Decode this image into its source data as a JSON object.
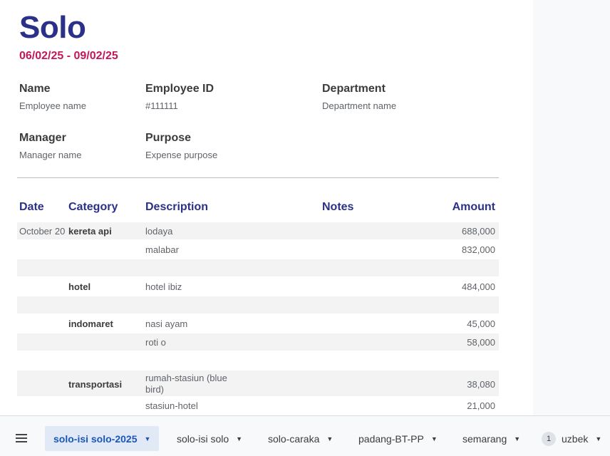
{
  "report": {
    "title": "Solo",
    "date_range": "06/02/25 - 09/02/25"
  },
  "info": {
    "name_label": "Name",
    "name_value": "Employee name",
    "employee_id_label": "Employee ID",
    "employee_id_value": "#111111",
    "department_label": "Department",
    "department_value": "Department name",
    "manager_label": "Manager",
    "manager_value": "Manager name",
    "purpose_label": "Purpose",
    "purpose_value": "Expense purpose"
  },
  "table": {
    "headers": {
      "date": "Date",
      "category": "Category",
      "description": "Description",
      "notes": "Notes",
      "amount": "Amount"
    },
    "rows": [
      {
        "date": "October 20",
        "category": "kereta api",
        "description": "lodaya",
        "notes": "",
        "amount": "688,000"
      },
      {
        "date": "",
        "category": "",
        "description": "malabar",
        "notes": "",
        "amount": "832,000"
      },
      {
        "date": "",
        "category": "",
        "description": "",
        "notes": "",
        "amount": ""
      },
      {
        "date": "",
        "category": "hotel",
        "description": "hotel ibiz",
        "notes": "",
        "amount": "484,000"
      },
      {
        "date": "",
        "category": "",
        "description": "",
        "notes": "",
        "amount": ""
      },
      {
        "date": "",
        "category": "indomaret",
        "description": "nasi ayam",
        "notes": "",
        "amount": "45,000"
      },
      {
        "date": "",
        "category": "",
        "description": "roti o",
        "notes": "",
        "amount": "58,000"
      },
      {
        "date": "",
        "category": "",
        "description": "",
        "notes": "",
        "amount": ""
      },
      {
        "date": "",
        "category": "transportasi",
        "description": "rumah-stasiun (blue bird)",
        "notes": "",
        "amount": "38,080"
      },
      {
        "date": "",
        "category": "",
        "description": "stasiun-hotel",
        "notes": "",
        "amount": "21,000"
      }
    ]
  },
  "sheet_tabs": [
    {
      "label": "solo-isi solo-2025",
      "active": true,
      "badge": ""
    },
    {
      "label": "solo-isi solo",
      "active": false,
      "badge": ""
    },
    {
      "label": "solo-caraka",
      "active": false,
      "badge": ""
    },
    {
      "label": "padang-BT-PP",
      "active": false,
      "badge": ""
    },
    {
      "label": "semarang",
      "active": false,
      "badge": ""
    },
    {
      "label": "uzbek",
      "active": false,
      "badge": "1"
    }
  ],
  "icons": {
    "menu": "menu-icon",
    "tab_dropdown": "chevron-down-icon"
  },
  "colors": {
    "title": "#2b3088",
    "date_range": "#c2185b",
    "header": "#2b3088",
    "active_tab_bg": "#e1e9f7",
    "active_tab_text": "#1a56b8"
  }
}
